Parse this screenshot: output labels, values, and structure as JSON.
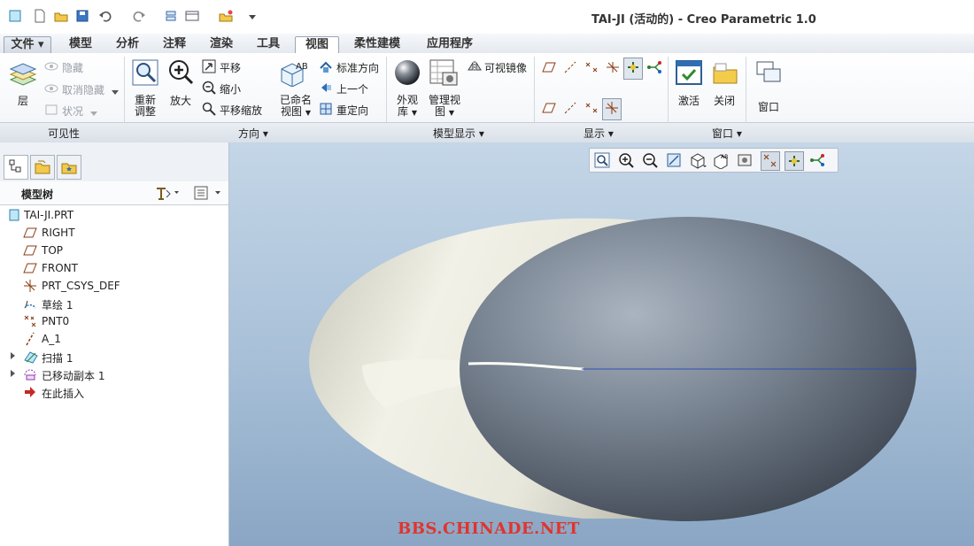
{
  "window": {
    "title": "TAI-JI (活动的) - Creo Parametric 1.0"
  },
  "tabs": [
    {
      "label": "文件 ▾"
    },
    {
      "label": "模型"
    },
    {
      "label": "分析"
    },
    {
      "label": "注释"
    },
    {
      "label": "渲染"
    },
    {
      "label": "工具"
    },
    {
      "label": "视图"
    },
    {
      "label": "柔性建模"
    },
    {
      "label": "应用程序"
    }
  ],
  "ribbon": {
    "visibility": {
      "layer": "层",
      "hide": "隐藏",
      "unhide": "取消隐藏",
      "status": "状况",
      "group": "可见性"
    },
    "orientation": {
      "refit_line1": "重新",
      "refit_line2": "调整",
      "zoom_in": "放大",
      "pan": "平移",
      "zoom_out": "缩小",
      "pan_zoom": "平移缩放",
      "saved_views_line1": "已命名",
      "saved_views_line2": "视图",
      "standard_orientation": "标准方向",
      "previous": "上一个",
      "reorient": "重定向",
      "group": "方向 ▾"
    },
    "model_display": {
      "appearance_line1": "外观",
      "appearance_line2": "库",
      "manage_views_line1": "管理视",
      "manage_views_line2": "图",
      "visible_mirror": "可视镜像",
      "group": "模型显示 ▾"
    },
    "display": {
      "group": "显示 ▾"
    },
    "window": {
      "activate": "激活",
      "close": "关闭",
      "window": "窗口",
      "group": "窗口 ▾"
    }
  },
  "model_tree": {
    "header": "模型树",
    "items": [
      {
        "label": "TAI-JI.PRT",
        "icon": "part-icon"
      },
      {
        "label": "RIGHT",
        "icon": "datum-plane-icon"
      },
      {
        "label": "TOP",
        "icon": "datum-plane-icon"
      },
      {
        "label": "FRONT",
        "icon": "datum-plane-icon"
      },
      {
        "label": "PRT_CSYS_DEF",
        "icon": "csys-icon"
      },
      {
        "label": "草绘 1",
        "icon": "sketch-icon"
      },
      {
        "label": "PNT0",
        "icon": "datum-point-icon"
      },
      {
        "label": "A_1",
        "icon": "datum-axis-icon"
      },
      {
        "label": "扫描 1",
        "icon": "sweep-icon"
      },
      {
        "label": "已移动副本 1",
        "icon": "moved-copy-icon"
      },
      {
        "label": "在此插入",
        "icon": "insert-here-icon"
      }
    ]
  },
  "viewport": {
    "watermark": "BBS.CHINADE.NET"
  },
  "colors": {
    "accent": "#2d6ab0",
    "viewport_top": "#c4d6e7",
    "viewport_bottom": "#8aa6c4",
    "watermark": "#e0342d"
  }
}
